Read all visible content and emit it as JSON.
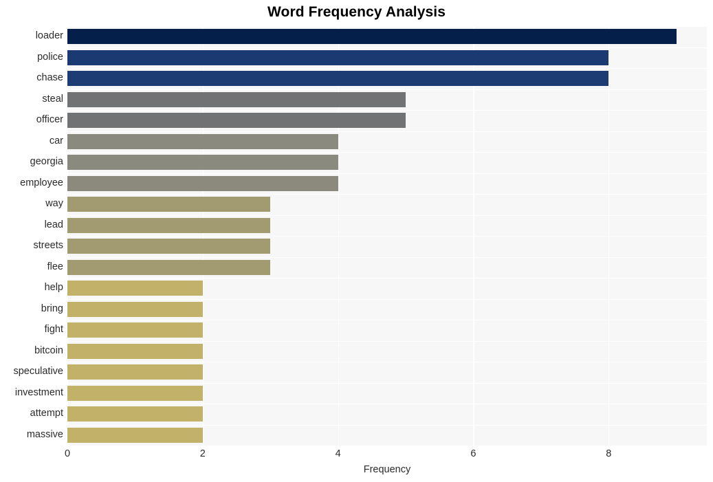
{
  "chart_data": {
    "type": "bar",
    "orientation": "horizontal",
    "title": "Word Frequency Analysis",
    "xlabel": "Frequency",
    "ylabel": "",
    "xlim": [
      0,
      9.45
    ],
    "ylim": [
      0,
      20
    ],
    "grid": true,
    "legend": null,
    "xticks": [
      0,
      2,
      4,
      6,
      8
    ],
    "xtick_labels": [
      "0",
      "2",
      "4",
      "6",
      "8"
    ],
    "categories": [
      "loader",
      "police",
      "chase",
      "steal",
      "officer",
      "car",
      "georgia",
      "employee",
      "way",
      "lead",
      "streets",
      "flee",
      "help",
      "bring",
      "fight",
      "bitcoin",
      "speculative",
      "investment",
      "attempt",
      "massive"
    ],
    "values": [
      9,
      8,
      8,
      5,
      5,
      4,
      4,
      4,
      3,
      3,
      3,
      3,
      2,
      2,
      2,
      2,
      2,
      2,
      2,
      2
    ],
    "bar_colors": [
      "#04204a",
      "#1b3a72",
      "#1d3c73",
      "#707274",
      "#717274",
      "#8b8a7e",
      "#8b8a7e",
      "#8b8a7d",
      "#a29b72",
      "#a29b72",
      "#a29b71",
      "#a29b71",
      "#c2b169",
      "#c2b169",
      "#c2b169",
      "#c2b169",
      "#c2b169",
      "#c2b169",
      "#c2b169",
      "#c2b169"
    ],
    "plot_background": "#f7f7f7",
    "grid_color": "#ffffff",
    "figure_background": "#ffffff"
  }
}
